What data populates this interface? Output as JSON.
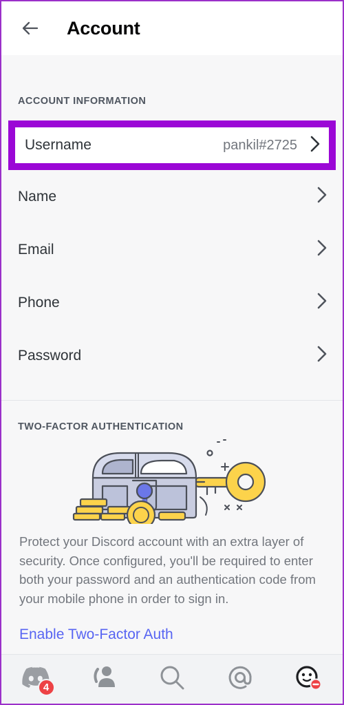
{
  "header": {
    "title": "Account",
    "back_icon": "arrow-left-icon"
  },
  "account_section": {
    "label": "ACCOUNT INFORMATION",
    "rows": [
      {
        "label": "Username",
        "value": "pankil#2725",
        "highlighted": true
      },
      {
        "label": "Name",
        "value": "",
        "highlighted": false
      },
      {
        "label": "Email",
        "value": "",
        "highlighted": false
      },
      {
        "label": "Phone",
        "value": "",
        "highlighted": false
      },
      {
        "label": "Password",
        "value": "",
        "highlighted": false
      }
    ]
  },
  "two_factor_section": {
    "label": "TWO-FACTOR AUTHENTICATION",
    "illustration": "treasure-chest-key-illustration",
    "description": "Protect your Discord account with an extra layer of security. Once configured, you'll be required to enter both your password and an authentication code from your mobile phone in order to sign in.",
    "enable_link": "Enable Two-Factor Auth"
  },
  "bottom_nav": {
    "items": [
      {
        "name": "servers-tab",
        "icon": "discord-logo-icon",
        "badge": "4"
      },
      {
        "name": "friends-tab",
        "icon": "friends-icon",
        "badge": ""
      },
      {
        "name": "search-tab",
        "icon": "search-icon",
        "badge": ""
      },
      {
        "name": "mentions-tab",
        "icon": "at-mention-icon",
        "badge": ""
      },
      {
        "name": "profile-tab",
        "icon": "user-avatar-icon",
        "badge": ""
      }
    ]
  },
  "colors": {
    "highlight_border": "#9b07d6",
    "accent_link": "#5865f2",
    "badge_red": "#ed4245",
    "text_primary": "#2e3338",
    "text_muted": "#72767d",
    "page_bg": "#f7f7f8"
  }
}
